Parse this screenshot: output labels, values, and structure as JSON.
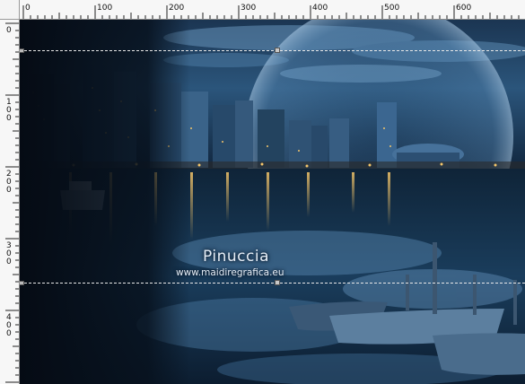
{
  "ruler": {
    "horizontal_labels": [
      "0",
      "100",
      "200",
      "300",
      "400",
      "500",
      "600"
    ],
    "vertical_labels": [
      "0",
      "100",
      "200",
      "300",
      "400"
    ]
  },
  "canvas": {
    "watermark_name": "Pinuccia",
    "watermark_url": "www.maidiregrafica.eu"
  },
  "colors": {
    "water_dark": "#0b1a2c",
    "water_mid": "#1f4a6e",
    "sky_blue": "#4d7fa8",
    "light_yellow": "#f5c66a",
    "guide_line": "#e8e8e8"
  }
}
